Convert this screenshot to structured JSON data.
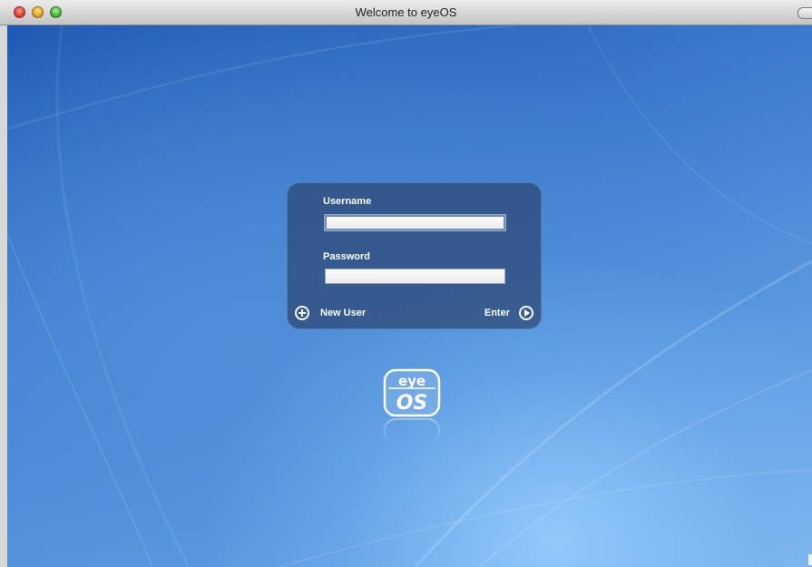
{
  "window": {
    "title": "Welcome to eyeOS"
  },
  "login": {
    "username_label": "Username",
    "username_value": "",
    "password_label": "Password",
    "password_value": "",
    "new_user_label": "New User",
    "enter_label": "Enter"
  },
  "logo": {
    "top_text": "eye",
    "bottom_text": "OS"
  },
  "icons": {
    "new_user": "plus-circle-icon",
    "enter": "arrow-right-circle-icon"
  },
  "colors": {
    "background_dark": "#1f58b3",
    "background_light": "#7fb6ef",
    "panel": "#2d4673"
  }
}
